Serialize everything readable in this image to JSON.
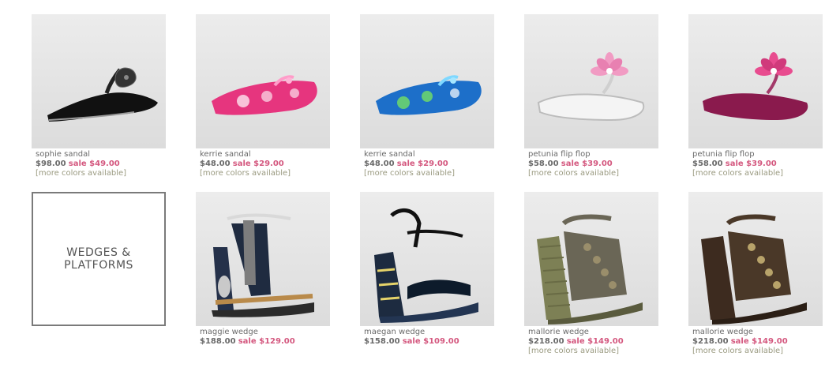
{
  "category": {
    "line1": "WEDGES &",
    "line2": "PLATFORMS"
  },
  "row1": [
    {
      "name": "sophie sandal",
      "orig": "$98.00",
      "sale": "sale $49.00",
      "more": "[more colors available]"
    },
    {
      "name": "kerrie sandal",
      "orig": "$48.00",
      "sale": "sale $29.00",
      "more": "[more colors available]"
    },
    {
      "name": "kerrie sandal",
      "orig": "$48.00",
      "sale": "sale $29.00",
      "more": "[more colors available]"
    },
    {
      "name": "petunia flip flop",
      "orig": "$58.00",
      "sale": "sale $39.00",
      "more": "[more colors available]"
    },
    {
      "name": "petunia flip flop",
      "orig": "$58.00",
      "sale": "sale $39.00",
      "more": "[more colors available]"
    }
  ],
  "row2": [
    {
      "name": "maggie wedge",
      "orig": "$188.00",
      "sale": "sale $129.00"
    },
    {
      "name": "maegan wedge",
      "orig": "$158.00",
      "sale": "sale $109.00"
    },
    {
      "name": "mallorie wedge",
      "orig": "$218.00",
      "sale": "sale $149.00",
      "more": "[more colors available]"
    },
    {
      "name": "mallorie wedge",
      "orig": "$218.00",
      "sale": "sale $149.00",
      "more": "[more colors available]"
    }
  ],
  "colors": {
    "sale": "#d4587f",
    "price": "#6a6a6a",
    "more": "#9a9a80",
    "border": "#7a7a7a"
  }
}
